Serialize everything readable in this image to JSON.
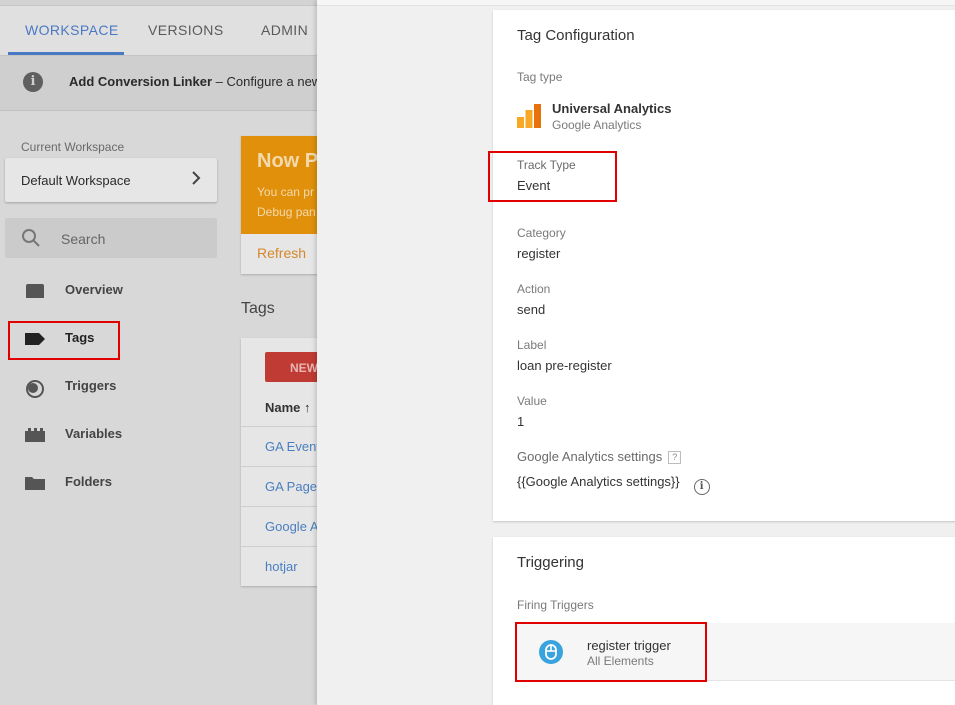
{
  "nav": {
    "tabs": [
      {
        "label": "WORKSPACE"
      },
      {
        "label": "VERSIONS"
      },
      {
        "label": "ADMIN"
      }
    ]
  },
  "infobar": {
    "title": "Add Conversion Linker",
    "separator": "–",
    "text": "Configure a new C"
  },
  "sidebar": {
    "workspace_label": "Current Workspace",
    "workspace_name": "Default Workspace",
    "search_placeholder": "Search",
    "items": [
      {
        "label": "Overview",
        "icon": "overview-icon"
      },
      {
        "label": "Tags",
        "icon": "tag-icon"
      },
      {
        "label": "Triggers",
        "icon": "trigger-icon"
      },
      {
        "label": "Variables",
        "icon": "variables-icon"
      },
      {
        "label": "Folders",
        "icon": "folder-icon"
      }
    ]
  },
  "publish_card": {
    "title": "Now Pr",
    "line1": "You can pr",
    "line2": "Debug pan",
    "refresh": "Refresh",
    "color": "#e0900a"
  },
  "tags_list": {
    "heading": "Tags",
    "new_button": "NEW",
    "column_name": "Name ↑",
    "rows": [
      "GA Event",
      "GA Pagev",
      "Google A",
      "hotjar"
    ]
  },
  "tag_config": {
    "title": "Tag Configuration",
    "tag_type_label": "Tag type",
    "tag_type_name": "Universal Analytics",
    "tag_type_vendor": "Google Analytics",
    "fields": [
      {
        "label": "Track Type",
        "value": "Event"
      },
      {
        "label": "Category",
        "value": "register"
      },
      {
        "label": "Action",
        "value": "send"
      },
      {
        "label": "Label",
        "value": "loan pre-register"
      },
      {
        "label": "Value",
        "value": "1"
      }
    ],
    "ga_settings_label": "Google Analytics settings",
    "ga_settings_help": "?",
    "ga_settings_value": "{{Google Analytics settings}}"
  },
  "triggering": {
    "title": "Triggering",
    "firing_label": "Firing Triggers",
    "trigger_name": "register trigger",
    "trigger_sub": "All Elements",
    "trigger_icon": "mouse-icon",
    "trigger_color": "#38a3dd"
  },
  "colors": {
    "accent": "#4a79c4",
    "highlight": "#e00000",
    "new_button": "#bf3b34"
  }
}
